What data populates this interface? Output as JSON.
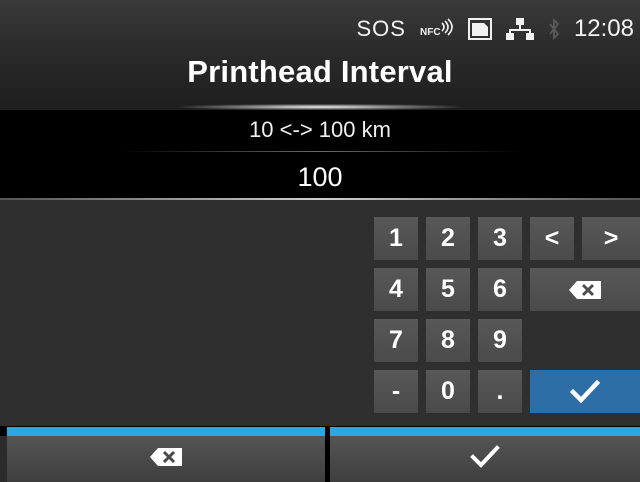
{
  "status_bar": {
    "sos": "SOS",
    "nfc_icon": "nfc-icon",
    "sd_card_icon": "sd-card-icon",
    "network_icon": "network-icon",
    "bluetooth_icon": "bluetooth-icon",
    "time": "12:08"
  },
  "header": {
    "title": "Printhead Interval"
  },
  "range": {
    "text": "10 <-> 100 km"
  },
  "input": {
    "value": "100"
  },
  "keypad": {
    "k1": "1",
    "k2": "2",
    "k3": "3",
    "k4": "4",
    "k5": "5",
    "k6": "6",
    "k7": "7",
    "k8": "8",
    "k9": "9",
    "minus": "-",
    "k0": "0",
    "dot": ".",
    "left": "<",
    "right": ">",
    "backspace_icon": "backspace-icon",
    "enter_icon": "checkmark-icon"
  },
  "footer": {
    "left_icon": "backspace-icon",
    "right_icon": "checkmark-icon"
  },
  "colors": {
    "accent": "#2aa7e4",
    "enter_key": "#2e6ea7",
    "key": "#505050",
    "workarea": "#2f2f2f"
  }
}
